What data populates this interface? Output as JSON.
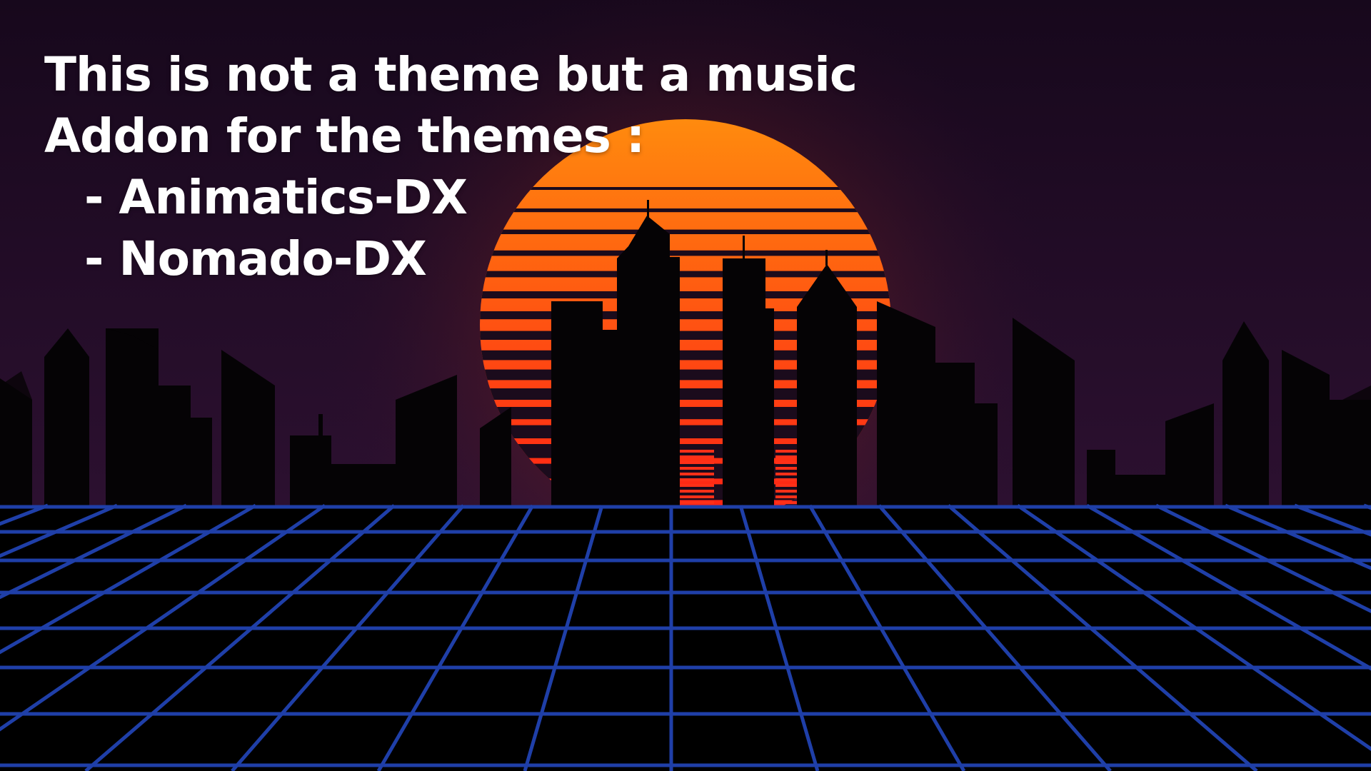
{
  "caption": {
    "line1": "This is not a theme but a music",
    "line2": "Addon for the themes :",
    "items": [
      "- Animatics-DX",
      "- Nomado-DX"
    ]
  },
  "colors": {
    "sky_top": "#1a0a1f",
    "sky_bottom": "#2a0f2e",
    "sun_top": "#ff8a0d",
    "sun_bottom": "#ff2a14",
    "sun_glow": "#ff5a1e",
    "grid_line": "#1f3fa8",
    "silhouette": "#050305"
  },
  "artwork": {
    "elements": [
      "sunset-sun",
      "city-skyline-silhouette",
      "neon-grid-floor"
    ]
  }
}
